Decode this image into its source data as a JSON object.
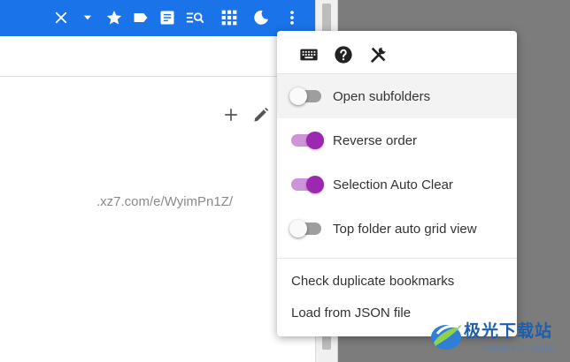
{
  "toolbar": {
    "icons": [
      "close-icon",
      "dropdown-arrow-icon",
      "star-icon",
      "label-icon",
      "note-icon",
      "search-list-icon",
      "grid-icon",
      "dark-mode-icon",
      "more-vert-icon"
    ]
  },
  "content": {
    "url_fragment": ".xz7.com/e/WyimPn1Z/"
  },
  "menu": {
    "icon_buttons": [
      "keyboard-icon",
      "help-icon",
      "tools-icon"
    ],
    "toggles": [
      {
        "label": "Open subfolders",
        "on": false
      },
      {
        "label": "Reverse order",
        "on": true
      },
      {
        "label": "Selection Auto Clear",
        "on": true
      },
      {
        "label": "Top folder auto grid view",
        "on": false
      }
    ],
    "items": [
      {
        "label": "Check duplicate bookmarks"
      },
      {
        "label": "Load from JSON file"
      }
    ]
  },
  "watermark": {
    "text": "极光下载站",
    "url": "www.xz7.com"
  },
  "colors": {
    "appbar": "#1a73e8",
    "accent": "#9c27b0",
    "accent_track": "#ce93d8",
    "overlay": "#7c7c7c"
  }
}
